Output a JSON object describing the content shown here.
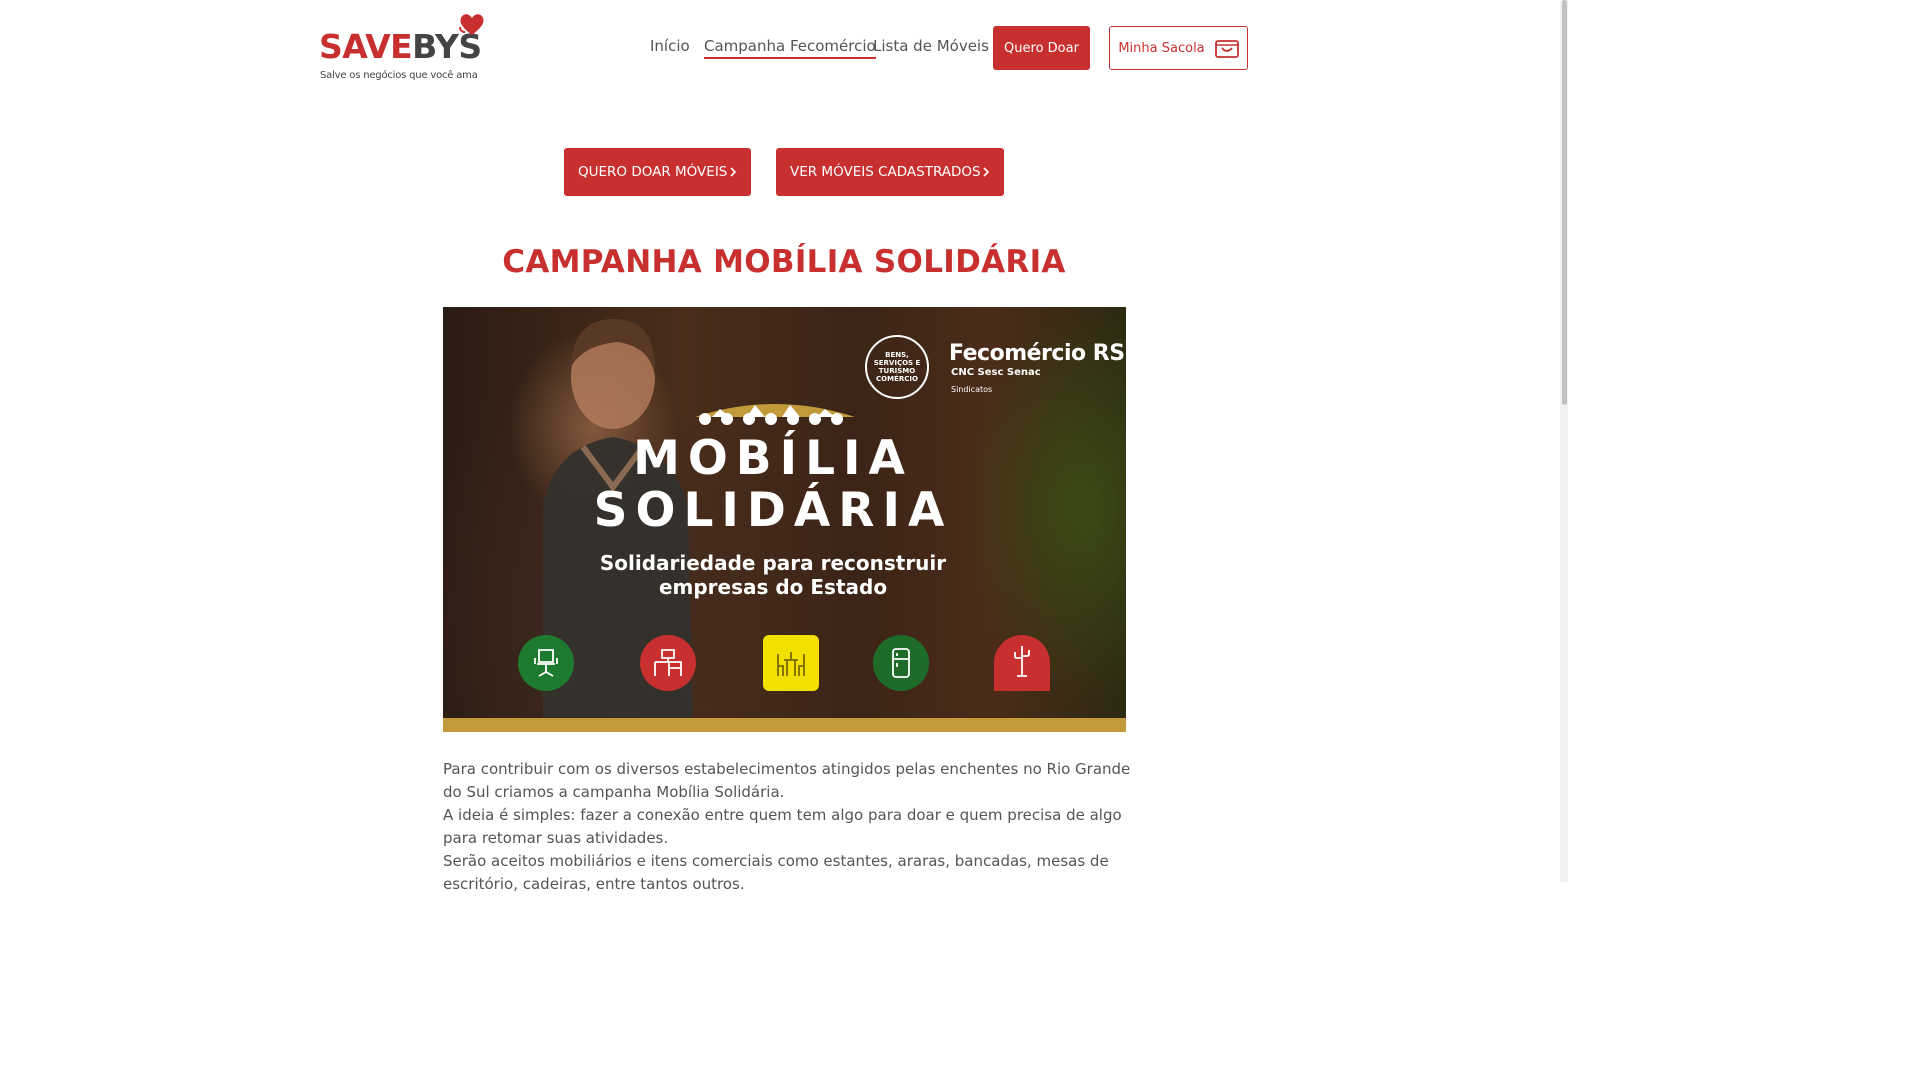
{
  "brand": {
    "name_part1": "SAVE",
    "name_part2": "BYS",
    "tagline": "Salve os negócios que você ama",
    "primary_color": "#c8302f"
  },
  "nav": {
    "items": [
      {
        "label": "Início",
        "active": false
      },
      {
        "label": "Campanha Fecomércio",
        "active": true
      },
      {
        "label": "Lista de Móveis",
        "active": false
      }
    ],
    "donate_button": "Quero Doar",
    "bag_button": "Minha Sacola",
    "bag_icon": "shopping-bag-icon"
  },
  "cta": {
    "donate_furniture": "QUERO DOAR MÓVEIS",
    "view_furniture": "VER MÓVEIS CADASTRADOS",
    "chevron_icon": "chevron-right-icon"
  },
  "page_title": "CAMPANHA MOBÍLIA SOLIDÁRIA",
  "banner": {
    "headline_line1": "MOBÍLIA",
    "headline_line2": "SOLIDÁRIA",
    "subtitle": "Solidariedade para reconstruir empresas do Estado",
    "partner_name": "Fecomércio RS",
    "partner_sub": "CNC Sesc Senac",
    "partner_sindicatos": "Sindicatos",
    "seal_text": "BENS, SERVIÇOS E TURISMO COMÉRCIO",
    "icons": [
      "office-chair-icon",
      "desk-icon",
      "dining-table-icon",
      "refrigerator-icon",
      "coat-rack-icon"
    ],
    "accent_color": "#c39a3a"
  },
  "body": {
    "paragraphs": [
      "Para contribuir com os diversos estabelecimentos atingidos pelas enchentes no Rio Grande do Sul criamos a campanha Mobília Solidária.",
      "A ideia é simples: fazer a conexão entre quem tem algo para doar e quem precisa de algo para retomar suas atividades.",
      "Serão aceitos mobiliários e itens comerciais como estantes, araras, bancadas, mesas de escritório, cadeiras, entre tantos outros."
    ]
  }
}
